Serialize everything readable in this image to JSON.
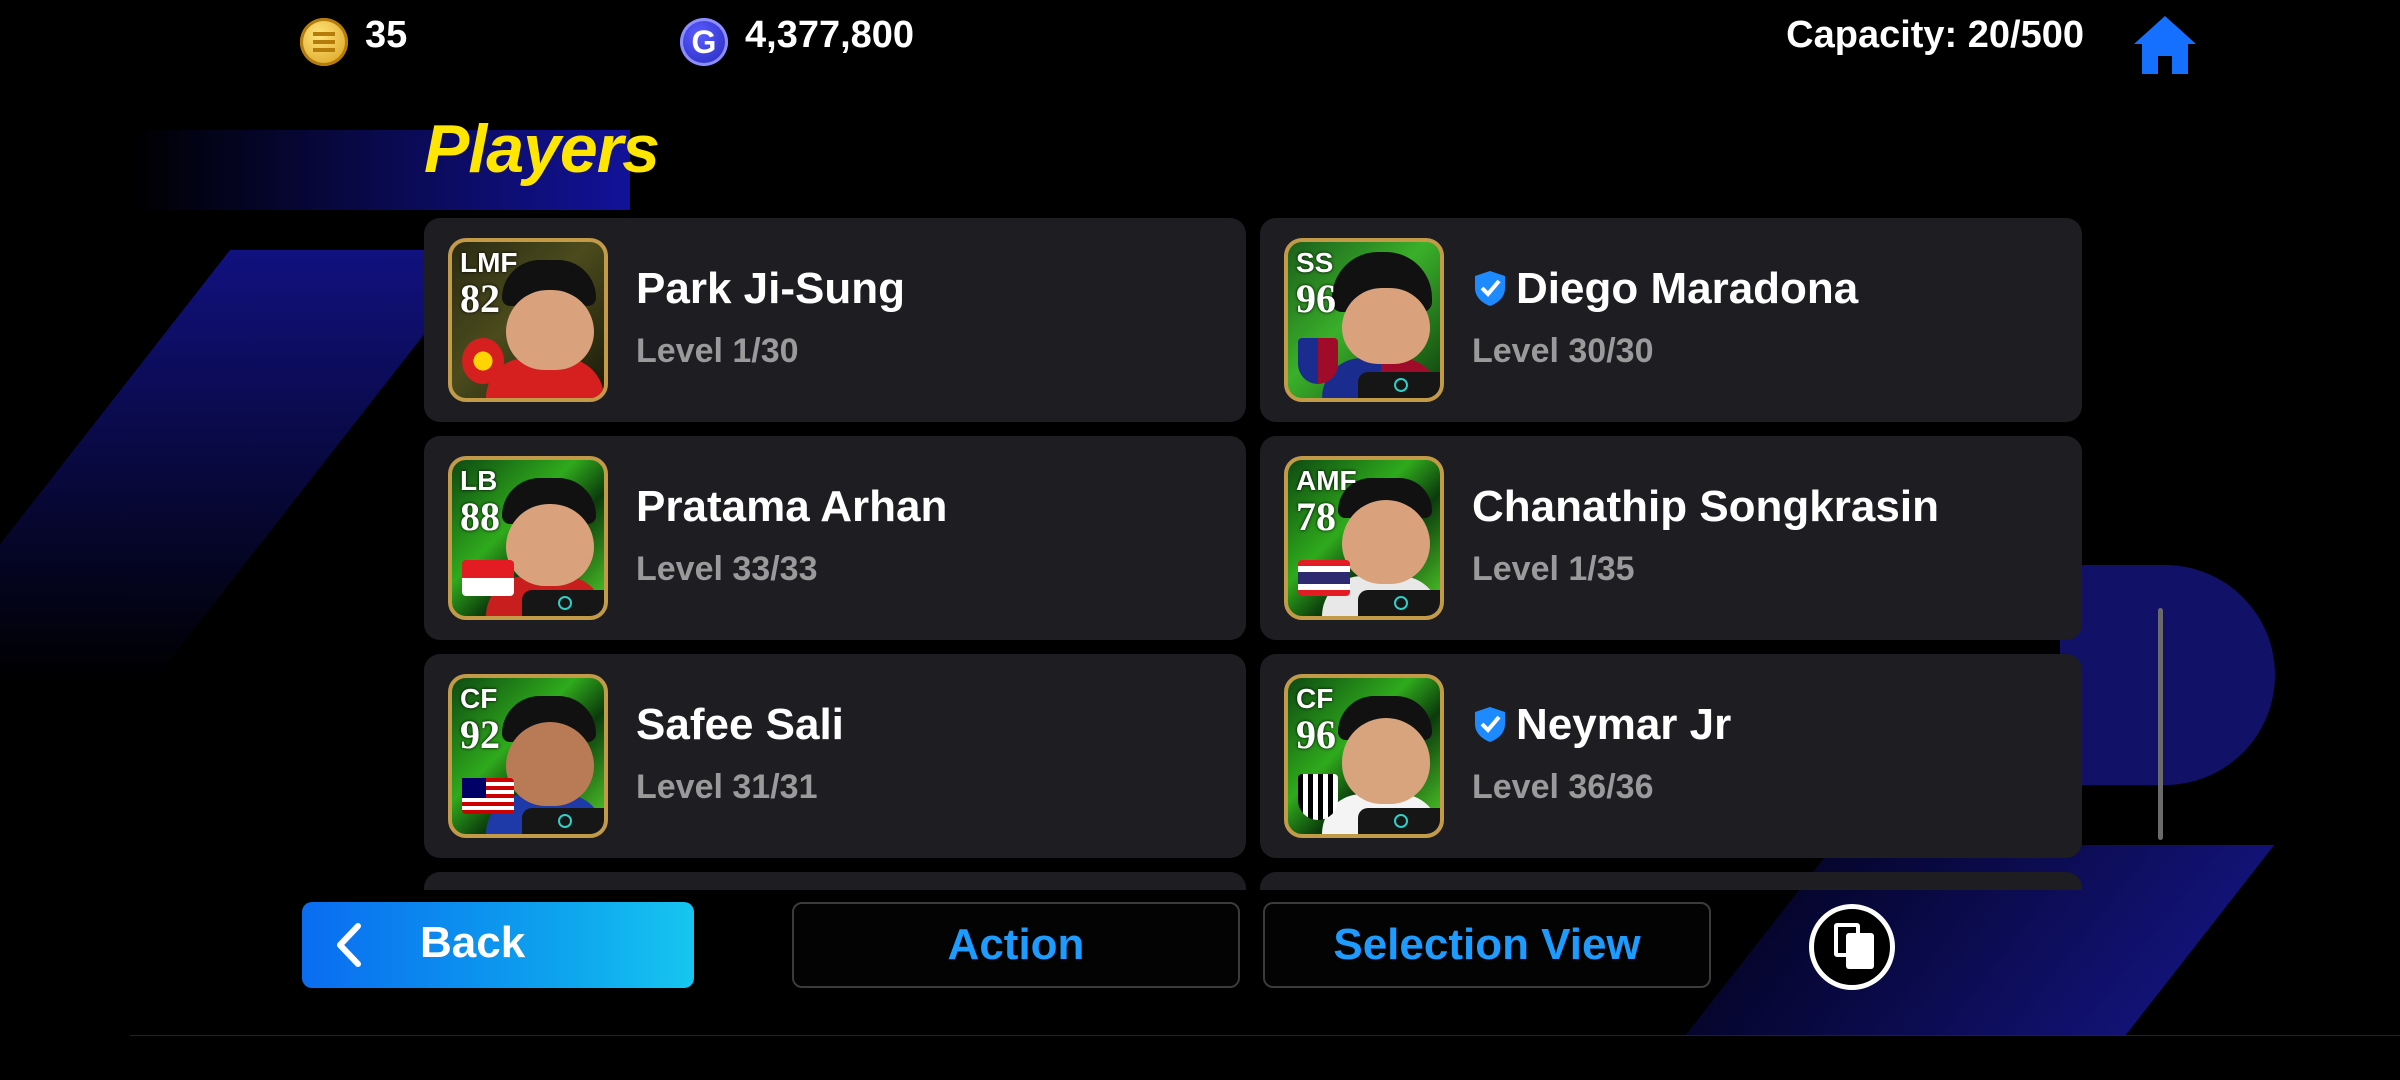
{
  "topbar": {
    "coins": "35",
    "gp_symbol": "G",
    "gp": "4,377,800",
    "capacity": "Capacity: 20/500"
  },
  "page_title": "Players",
  "players": [
    {
      "position": "LMF",
      "rating": "82",
      "name": "Park Ji-Sung",
      "level": "Level 1/30"
    },
    {
      "position": "SS",
      "rating": "96",
      "name": "Diego Maradona",
      "level": "Level 30/30"
    },
    {
      "position": "LB",
      "rating": "88",
      "name": "Pratama Arhan",
      "level": "Level 33/33"
    },
    {
      "position": "AMF",
      "rating": "78",
      "name": "Chanathip Songkrasin",
      "level": "Level 1/35"
    },
    {
      "position": "CF",
      "rating": "92",
      "name": "Safee Sali",
      "level": "Level 31/31"
    },
    {
      "position": "CF",
      "rating": "96",
      "name": "Neymar Jr",
      "level": "Level 36/36"
    }
  ],
  "buttons": {
    "back": "Back",
    "action": "Action",
    "selection_view": "Selection View"
  },
  "colors": {
    "title": "#ffe600",
    "accent_blue": "#1d9bff",
    "card_bg": "#1d1d22"
  }
}
